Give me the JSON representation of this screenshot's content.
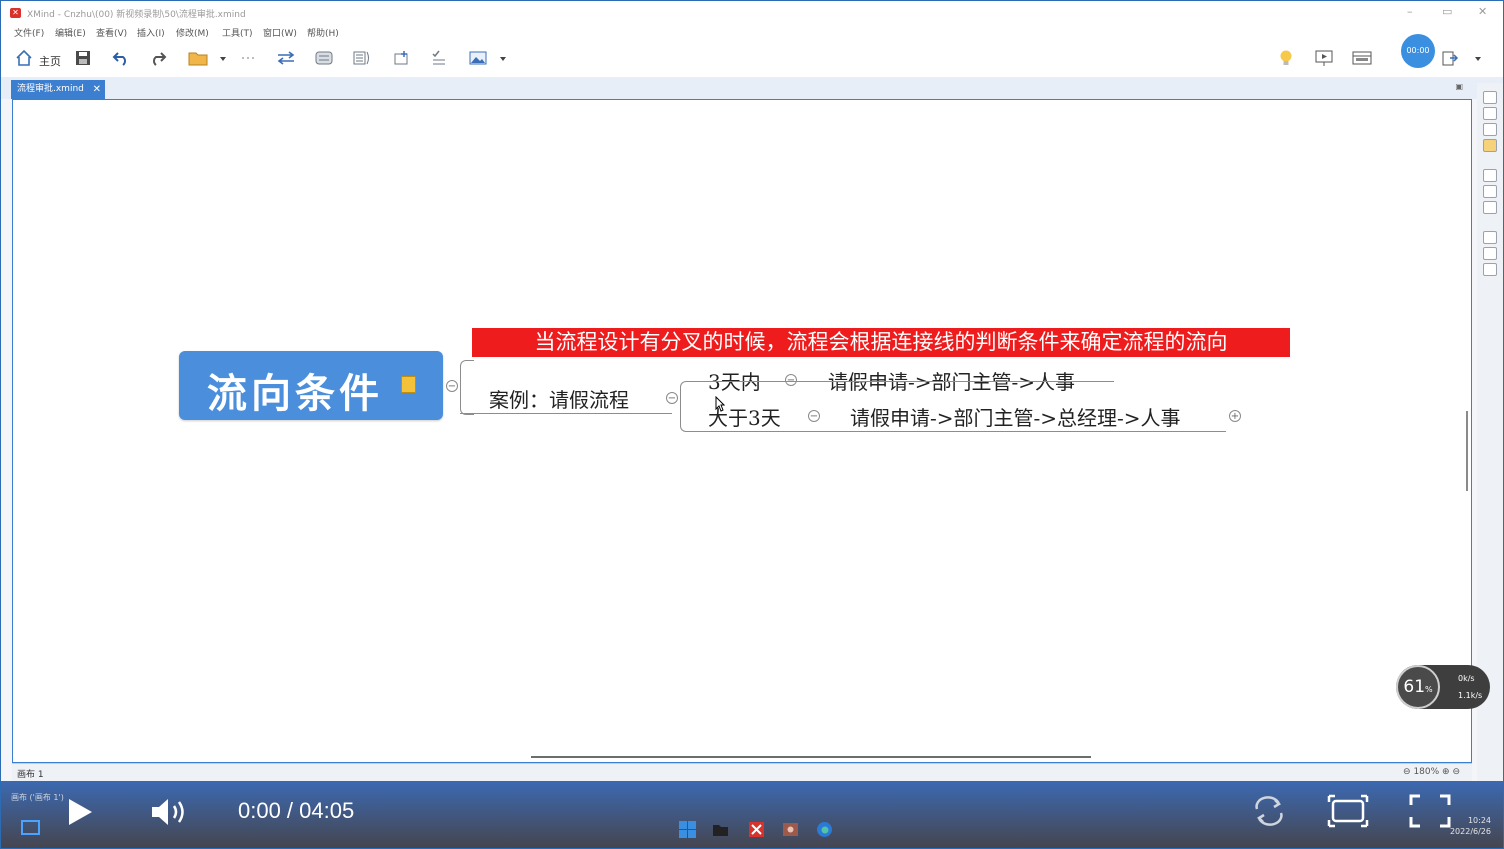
{
  "window": {
    "title": "XMind - Cnzhu\\(00) 新视频录制\\50\\流程审批.xmind",
    "minimize": "–",
    "restore": "▭",
    "close": "✕"
  },
  "menubar": {
    "items": [
      "文件(F)",
      "编辑(E)",
      "查看(V)",
      "插入(I)",
      "修改(M)",
      "工具(T)",
      "窗口(W)",
      "帮助(H)"
    ]
  },
  "toolbar": {
    "home_label": "主页",
    "timer": "00:00"
  },
  "tab": {
    "label": "流程审批.xmind",
    "close": "✕"
  },
  "mindmap": {
    "central_topic": "流向条件",
    "banner": "当流程设计有分叉的时候，流程会根据连接线的判断条件来确定流程的流向",
    "case_topic": "案例：请假流程",
    "branches": [
      {
        "condition": "3天内",
        "flow": "请假申请->部门主管->人事"
      },
      {
        "condition": "大于3天",
        "flow": "请假申请->部门主管->总经理->人事"
      }
    ]
  },
  "statusbar": {
    "sheet": "画布 1",
    "zoom": "180%"
  },
  "network_widget": {
    "percent": "61",
    "percent_sign": "%",
    "up": "0k/s",
    "down": "1.1k/s"
  },
  "video": {
    "time": "0:00 / 04:05",
    "status_left": "画布 ('画布 1')"
  },
  "taskbar": {
    "time": "10:24",
    "date": "2022/6/26"
  }
}
